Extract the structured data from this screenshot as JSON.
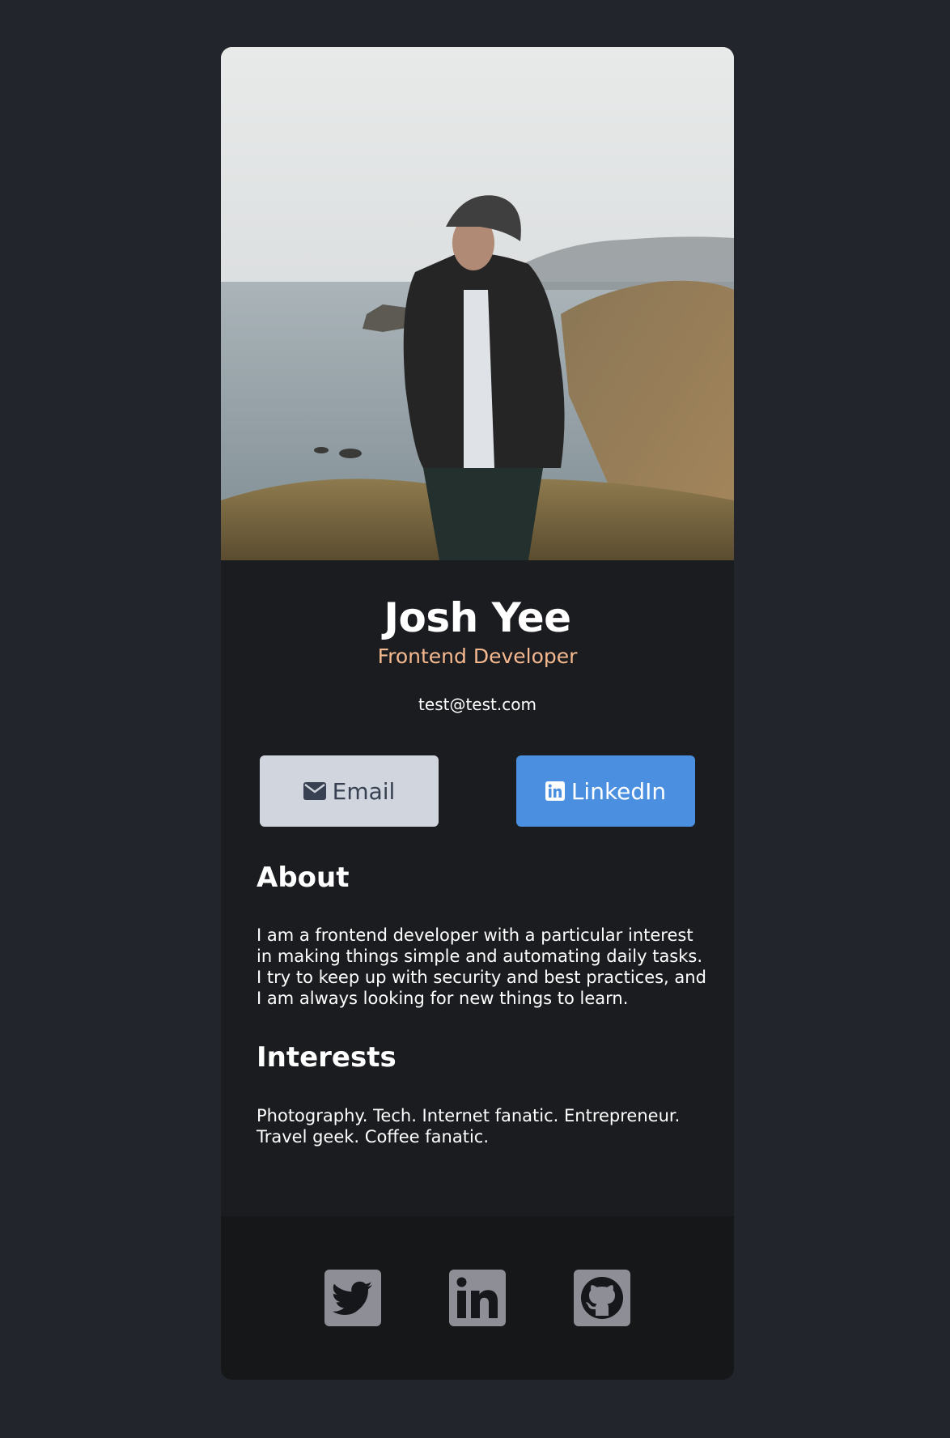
{
  "profile": {
    "name": "Josh Yee",
    "role": "Frontend Developer",
    "email": "test@test.com"
  },
  "buttons": {
    "email_label": "Email",
    "linkedin_label": "LinkedIn"
  },
  "about": {
    "title": "About",
    "body": "I am a frontend developer with a particular interest in making things simple and automating daily tasks. I try to keep up with security and best practices, and I am always looking for new things to learn."
  },
  "interests": {
    "title": "Interests",
    "body": "Photography. Tech. Internet fanatic. Entrepreneur. Travel geek. Coffee fanatic."
  },
  "footer": {
    "icons": [
      "twitter-icon",
      "linkedin-icon",
      "github-icon"
    ]
  },
  "colors": {
    "page_background": "#23252c",
    "card_background": "#1b1c20",
    "footer_background": "#161719",
    "accent_orange": "#f4b98f",
    "linkedin_blue": "#4a8fe0",
    "email_button": "#d1d5dd",
    "social_icon": "#8e8e96"
  }
}
